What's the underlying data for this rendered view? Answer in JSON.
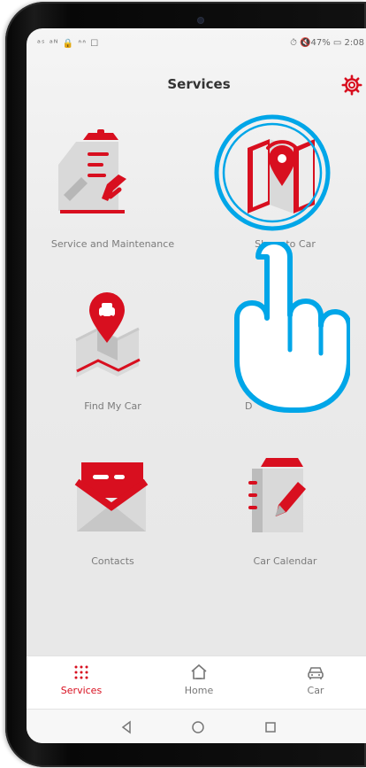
{
  "status_bar": {
    "left": "ᵃˢ ᵃᴺ 🔒 ᐢᐢ ☐",
    "right": "⏱ 🔇47% ▭ 2:08"
  },
  "header": {
    "title": "Services"
  },
  "tiles": [
    {
      "label": "Service and Maintenance"
    },
    {
      "label": "Share to Car"
    },
    {
      "label": "Find My Car"
    },
    {
      "label": "D"
    },
    {
      "label": "Contacts"
    },
    {
      "label": "Car Calendar"
    }
  ],
  "bottom_nav": {
    "items": [
      {
        "label": "Services"
      },
      {
        "label": "Home"
      },
      {
        "label": "Car"
      }
    ],
    "active_index": 0
  },
  "colors": {
    "accent": "#d80f1f",
    "muted_text": "#7b7b7b",
    "highlight": "#00a6e8",
    "screen_bg": "#ececec"
  },
  "icons": {
    "settings": "gear-icon",
    "service": "clipboard-wrench-icon",
    "share": "map-pin-wifi-icon",
    "find_car": "map-car-pin-icon",
    "contacts": "envelope-card-icon",
    "calendar": "notebook-pen-icon",
    "services_nav": "grid-dots-icon",
    "home_nav": "home-icon",
    "car_nav": "car-icon",
    "back": "triangle-back-icon",
    "home_sys": "circle-home-icon",
    "recent": "square-recent-icon",
    "tap_gesture": "hand-pointer-icon"
  }
}
